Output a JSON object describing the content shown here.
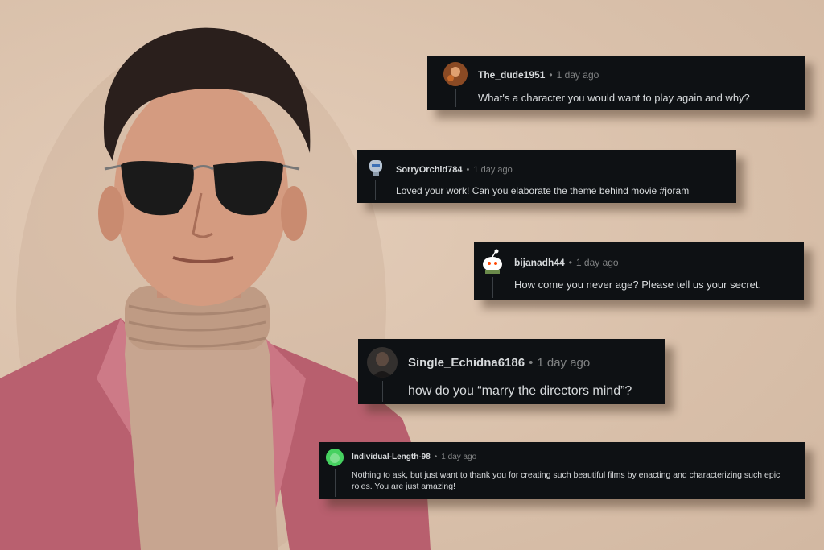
{
  "comments": [
    {
      "username": "The_dude1951",
      "separator": "•",
      "time": "1 day ago",
      "text": "What's a character you would want to play again and why?"
    },
    {
      "username": "SorryOrchid784",
      "separator": "•",
      "time": "1 day ago",
      "text": "Loved your work! Can you elaborate the theme behind movie #joram"
    },
    {
      "username": "bijanadh44",
      "separator": "•",
      "time": "1 day ago",
      "text": "How come you never age? Please tell us your secret."
    },
    {
      "username": "Single_Echidna6186",
      "separator": "•",
      "time": "1 day ago",
      "text": "how do you “marry the directors mind”?"
    },
    {
      "username": "Individual-Length-98",
      "separator": "•",
      "time": "1 day ago",
      "text": "Nothing to ask, but just want to thank you for creating such beautiful films by enacting and characterizing such epic roles. You are just amazing!"
    }
  ],
  "colors": {
    "background": "#dcc4b0",
    "card": "#0e1114",
    "text": "#d7dadc",
    "muted": "#818384",
    "blazer": "#c06a78",
    "turtleneck": "#c9a892",
    "avatar_green": "#46d160"
  }
}
